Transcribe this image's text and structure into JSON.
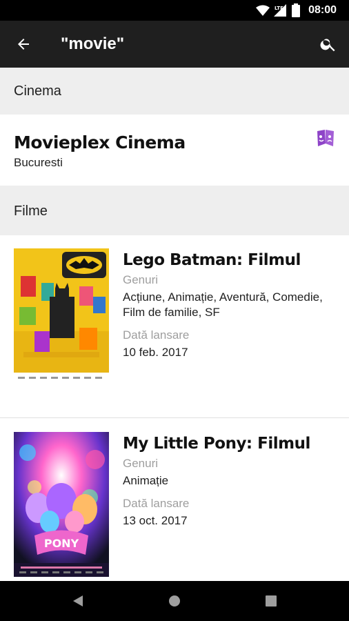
{
  "status_bar": {
    "time": "08:00",
    "network": "LTE"
  },
  "app_bar": {
    "title": "\"movie\"",
    "back_icon": "arrow-back-icon",
    "search_icon": "search-icon"
  },
  "cinema_section": {
    "header": "Cinema",
    "items": [
      {
        "name": "Movieplex Cinema",
        "city": "Bucuresti",
        "brand_icon": "cinema-brand-icon",
        "brand_color": "#8e44c8"
      }
    ]
  },
  "movies_section": {
    "header": "Filme",
    "items": [
      {
        "title": "Lego Batman: Filmul",
        "genres_label": "Genuri",
        "genres": "Acțiune, Animație, Aventură, Comedie, Film de familie, SF",
        "release_label": "Dată lansare",
        "release_date": "10 feb. 2017",
        "poster_icon": "lego-batman-poster"
      },
      {
        "title": "My Little Pony: Filmul",
        "genres_label": "Genuri",
        "genres": "Animație",
        "release_label": "Dată lansare",
        "release_date": "13 oct. 2017",
        "poster_icon": "my-little-pony-poster"
      }
    ]
  },
  "nav_bar": {
    "back_icon": "nav-back-icon",
    "home_icon": "nav-home-icon",
    "recents_icon": "nav-recents-icon"
  },
  "colors": {
    "app_bar": "#1f1f1f",
    "section_bg": "#eeeeee",
    "accent": "#8e44c8"
  }
}
